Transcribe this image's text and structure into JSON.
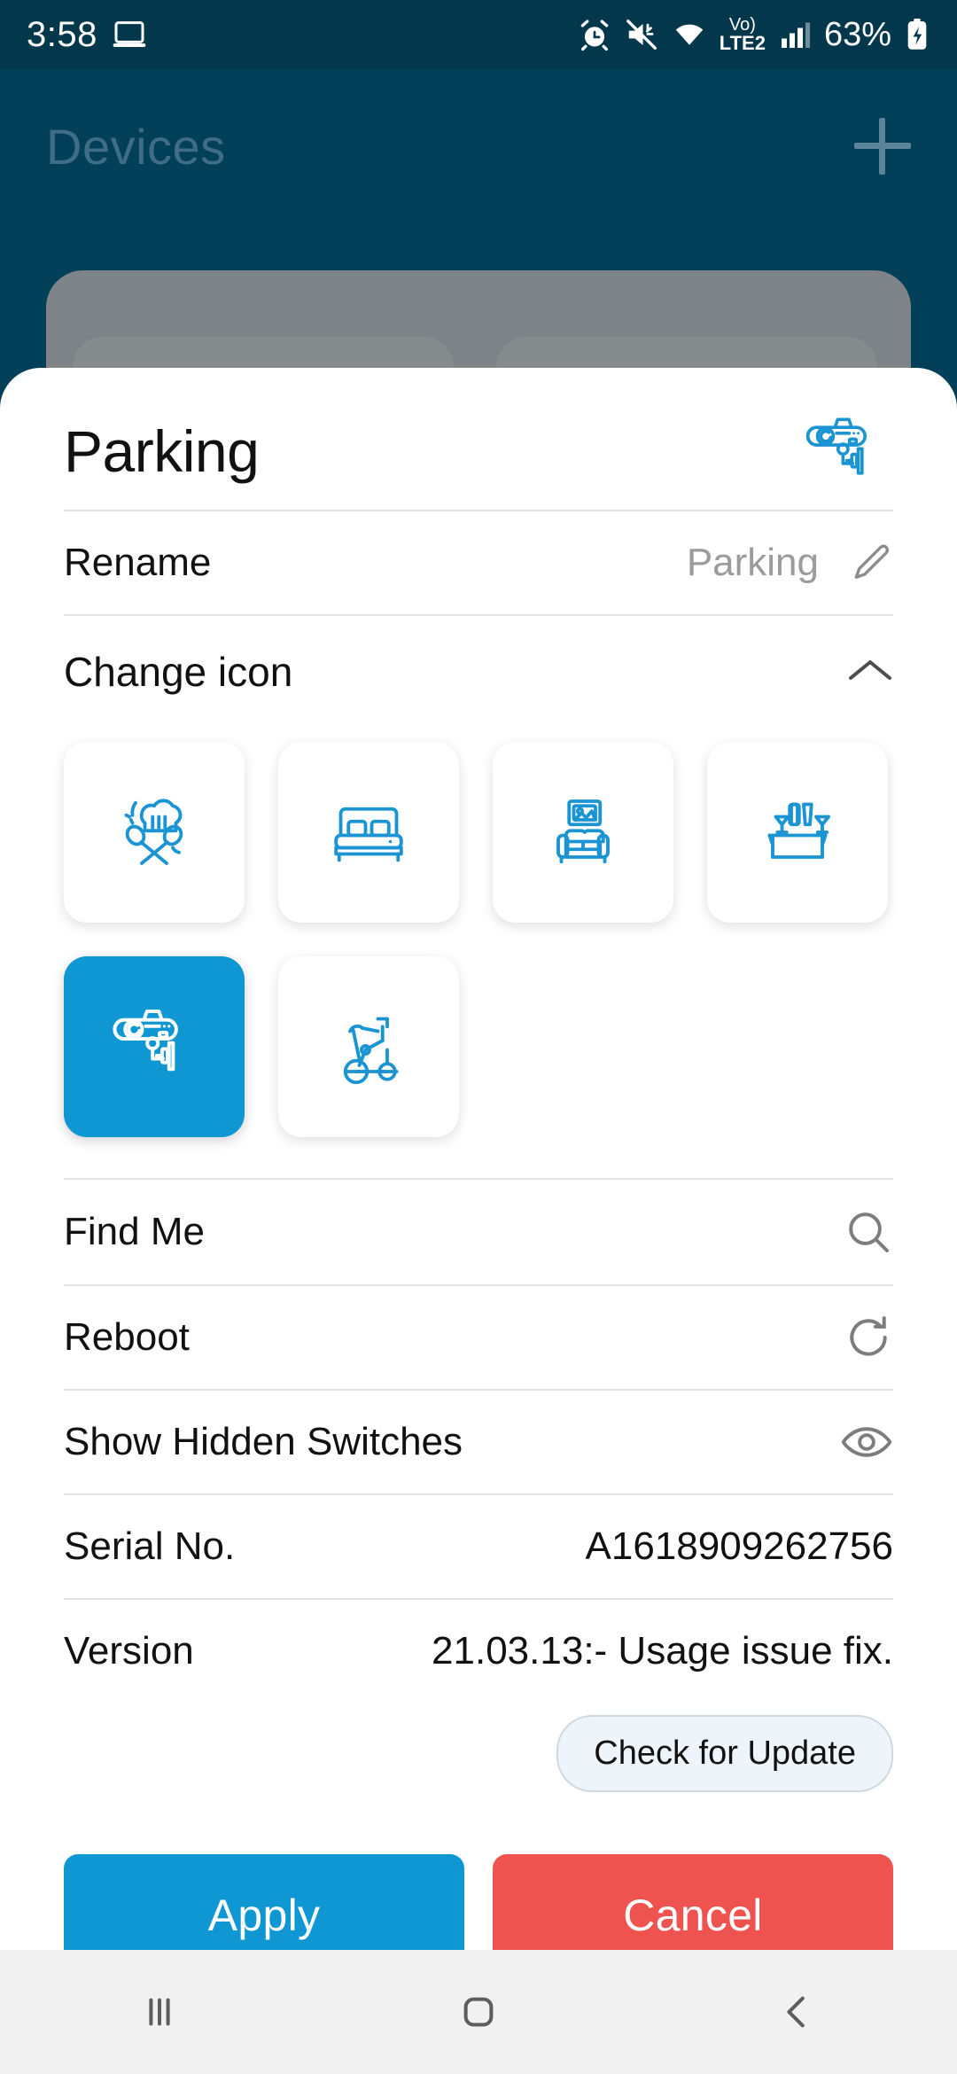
{
  "status_bar": {
    "time": "3:58",
    "battery_percent": "63%",
    "network_label": "LTE2",
    "voice_over_label": "Vo)",
    "icons": [
      "laptop-icon",
      "alarm-icon",
      "mute-icon",
      "wifi-icon",
      "signal-icon",
      "battery-icon"
    ]
  },
  "background_app": {
    "title": "Devices",
    "add_label": "+"
  },
  "sheet": {
    "title": "Parking",
    "header_icon": "cctv-camera-icon",
    "rename": {
      "label": "Rename",
      "value": "Parking",
      "edit_icon": "pencil-icon"
    },
    "change_icon": {
      "label": "Change icon",
      "collapse_icon": "chevron-up-icon",
      "options": [
        {
          "name": "kitchen-icon",
          "selected": false
        },
        {
          "name": "bedroom-icon",
          "selected": false
        },
        {
          "name": "living-room-icon",
          "selected": false
        },
        {
          "name": "bar-table-icon",
          "selected": false
        },
        {
          "name": "cctv-camera-icon",
          "selected": true
        },
        {
          "name": "exercise-bike-icon",
          "selected": false
        }
      ]
    },
    "actions_list": [
      {
        "label": "Find Me",
        "icon": "search-icon"
      },
      {
        "label": "Reboot",
        "icon": "refresh-icon"
      },
      {
        "label": "Show Hidden Switches",
        "icon": "eye-icon"
      }
    ],
    "serial": {
      "label": "Serial No.",
      "value": "A1618909262756"
    },
    "version": {
      "label": "Version",
      "value": "21.03.13:- Usage issue fix."
    },
    "check_update_label": "Check for Update",
    "apply_label": "Apply",
    "cancel_label": "Cancel"
  },
  "nav_bar": {
    "recents": "recents-icon",
    "home": "home-icon",
    "back": "back-icon"
  },
  "colors": {
    "accent_blue": "#0f97d4",
    "cancel_red": "#ef5350",
    "app_background": "#024059",
    "status_bar": "#03374c"
  }
}
